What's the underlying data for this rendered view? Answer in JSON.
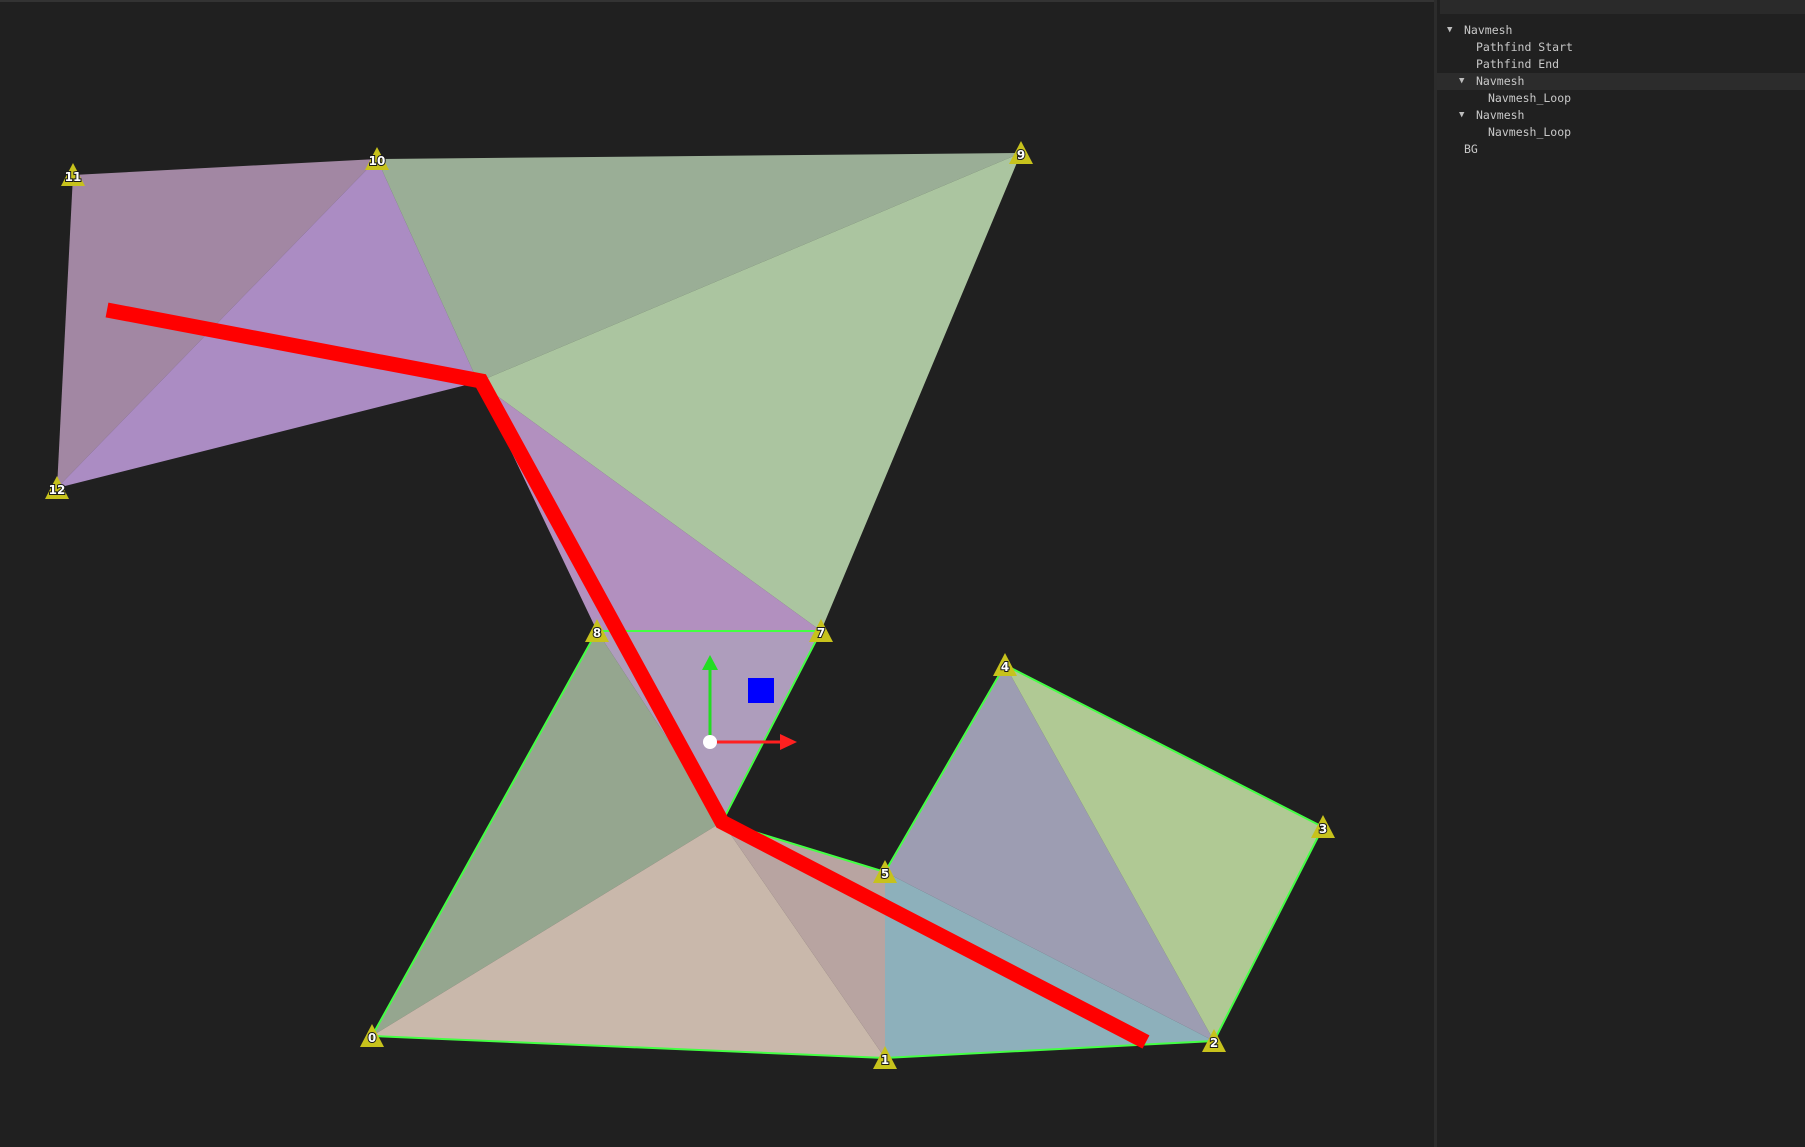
{
  "viewport": {
    "vertex_labels": [
      "0",
      "1",
      "2",
      "3",
      "4",
      "5",
      "7",
      "8",
      "9",
      "10",
      "11",
      "12"
    ],
    "colors": {
      "background": "#202020",
      "path": "#ff0000",
      "outline": "#44ff44",
      "vertex_marker": "#c7c21c",
      "gizmo_x": "#ff2020",
      "gizmo_y": "#22dd22",
      "gizmo_origin": "#ffffff",
      "handle": "#0000ff"
    },
    "icons": {
      "gizmo": "move-gizmo-icon",
      "handle": "blue-square-handle",
      "vertex": "triangle-marker-icon"
    }
  },
  "outliner": {
    "items": [
      {
        "label": "Navmesh",
        "expanded": true,
        "arrow": "▼"
      },
      {
        "label": "Pathfind Start"
      },
      {
        "label": "Pathfind End"
      },
      {
        "label": "Navmesh",
        "expanded": true,
        "arrow": "▼",
        "selected": true
      },
      {
        "label": "Navmesh_Loop"
      },
      {
        "label": "Navmesh",
        "expanded": true,
        "arrow": "▼"
      },
      {
        "label": "Navmesh_Loop"
      },
      {
        "label": "BG"
      }
    ]
  }
}
